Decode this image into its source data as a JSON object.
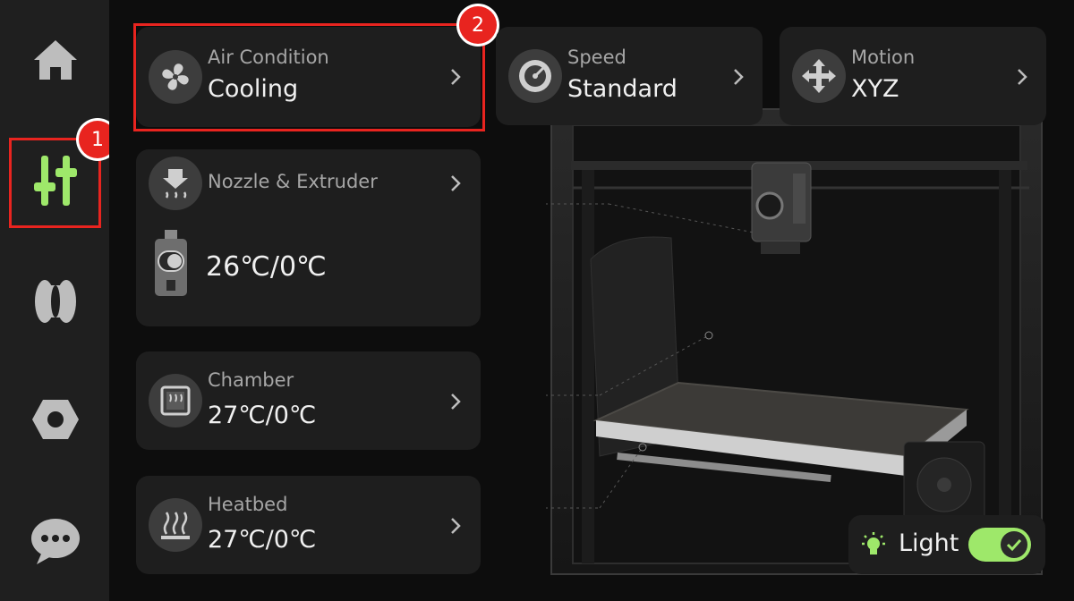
{
  "sidebar": {
    "items": [
      {
        "name": "home-icon"
      },
      {
        "name": "controls-icon",
        "active": true
      },
      {
        "name": "filament-icon"
      },
      {
        "name": "settings-nut-icon"
      },
      {
        "name": "chat-icon"
      }
    ]
  },
  "cards": {
    "air_condition": {
      "label": "Air Condition",
      "value": "Cooling",
      "icon": "fan-icon"
    },
    "speed": {
      "label": "Speed",
      "value": "Standard",
      "icon": "speedometer-icon"
    },
    "motion": {
      "label": "Motion",
      "value": "XYZ",
      "icon": "move-arrows-icon"
    },
    "nozzle": {
      "label": "Nozzle & Extruder",
      "value": "26℃/0℃",
      "icon": "nozzle-heat-icon"
    },
    "chamber": {
      "label": "Chamber",
      "value": "27℃/0℃",
      "icon": "chamber-icon"
    },
    "heatbed": {
      "label": "Heatbed",
      "value": "27℃/0℃",
      "icon": "heatbed-icon"
    }
  },
  "light": {
    "label": "Light",
    "on": true
  },
  "annotations": {
    "badge1": "1",
    "badge2": "2"
  },
  "colors": {
    "accent": "#9ee86a",
    "highlight": "#e8241f"
  }
}
